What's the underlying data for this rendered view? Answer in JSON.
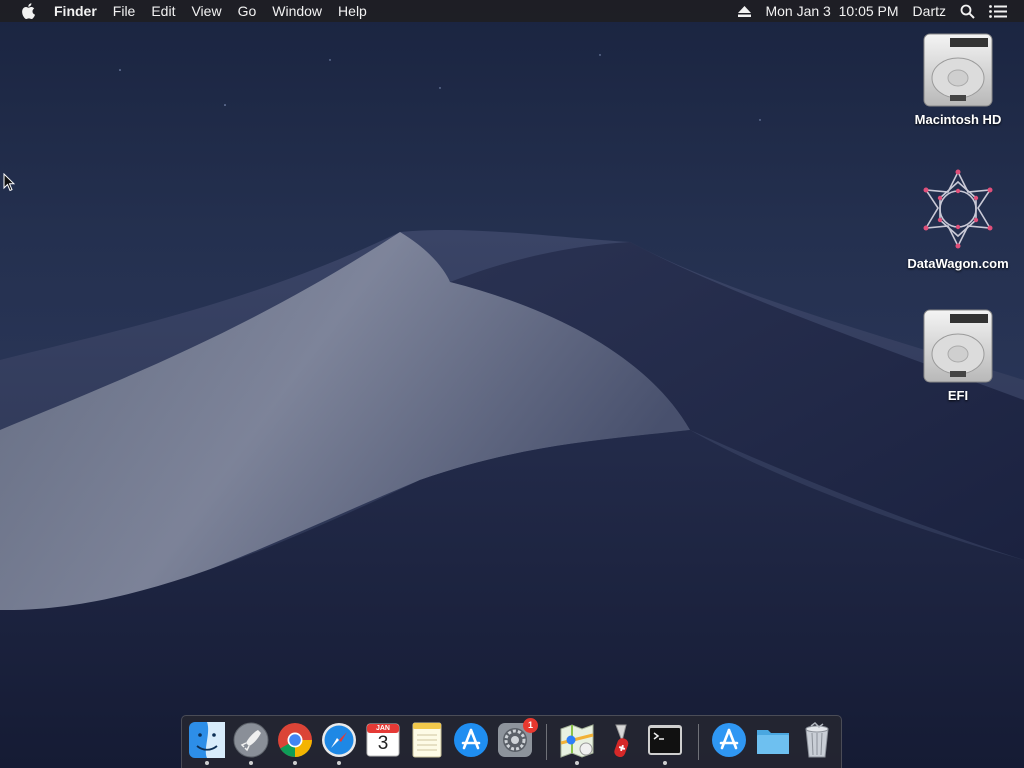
{
  "menubar": {
    "app_name": "Finder",
    "menus": [
      "File",
      "Edit",
      "View",
      "Go",
      "Window",
      "Help"
    ],
    "clock": "Mon Jan 3  10:05 PM",
    "user": "Dartz"
  },
  "desktop_icons": [
    {
      "label": "Macintosh HD",
      "icon": "hard-drive-icon"
    },
    {
      "label": "DataWagon.com",
      "icon": "datawagon-logo-icon"
    },
    {
      "label": "EFI",
      "icon": "hard-drive-icon"
    }
  ],
  "dock": {
    "items": [
      {
        "name": "Finder",
        "icon": "finder-icon",
        "running": true
      },
      {
        "name": "Launchpad",
        "icon": "launchpad-icon",
        "running": true
      },
      {
        "name": "Google Chrome",
        "icon": "chrome-icon",
        "running": true
      },
      {
        "name": "Safari",
        "icon": "safari-icon",
        "running": true
      },
      {
        "name": "Calendar",
        "icon": "calendar-icon",
        "running": false,
        "month": "JAN",
        "day": "3"
      },
      {
        "name": "Notes",
        "icon": "notes-icon",
        "running": false
      },
      {
        "name": "App Store",
        "icon": "app-store-icon",
        "running": false
      },
      {
        "name": "System Preferences",
        "icon": "system-preferences-icon",
        "running": false,
        "badge": "1"
      },
      {
        "name": "Maps",
        "icon": "maps-icon",
        "running": true
      },
      {
        "name": "Swiss Army Knife",
        "icon": "knife-icon",
        "running": false
      },
      {
        "name": "Terminal",
        "icon": "terminal-icon",
        "running": true
      },
      {
        "name": "Applications",
        "icon": "applications-folder-icon",
        "running": false
      },
      {
        "name": "Folder",
        "icon": "folder-icon",
        "running": false
      },
      {
        "name": "Trash",
        "icon": "trash-icon",
        "running": false
      }
    ]
  },
  "colors": {
    "menubar_bg": "#1e1e23",
    "sky_top": "#1a2440",
    "badge_red": "#e8382f"
  }
}
